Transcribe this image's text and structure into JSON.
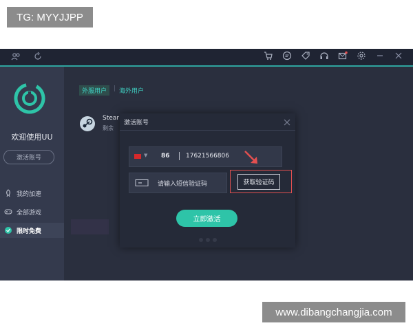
{
  "watermarks": {
    "top_left": "TG: MYYJJPP",
    "bottom_right": "www.dibangchangjia.com"
  },
  "titlebar": {
    "left_icons": [
      "users-icon",
      "refresh-icon"
    ],
    "right_icons": [
      "cart-icon",
      "message-icon",
      "tag-icon",
      "headset-icon",
      "mail-icon",
      "settings-icon",
      "minimize-icon",
      "close-icon"
    ]
  },
  "sidebar": {
    "welcome": "欢迎使用UU",
    "activate_button": "激活账号",
    "items": [
      {
        "label": "我的加速",
        "icon": "rocket-icon"
      },
      {
        "label": "全部游戏",
        "icon": "gamepad-icon"
      },
      {
        "label": "限时免费",
        "icon": "gift-icon"
      }
    ]
  },
  "main": {
    "tabs": [
      {
        "label": "外服用户"
      },
      {
        "label": "海外用户"
      }
    ],
    "game": {
      "name": "Stear",
      "subtitle": "剩余"
    }
  },
  "modal": {
    "title": "激活账号",
    "country_code": "86",
    "phone_number": "17621566806",
    "code_placeholder": "请输入短信验证码",
    "get_code_button": "获取验证码",
    "activate_button": "立即激活"
  },
  "colors": {
    "accent": "#2ec4a8",
    "title_bar": "#1f2433",
    "sidebar_bg": "#343a4d",
    "main_bg": "#2a2f3e",
    "highlight_red": "#e35050"
  }
}
